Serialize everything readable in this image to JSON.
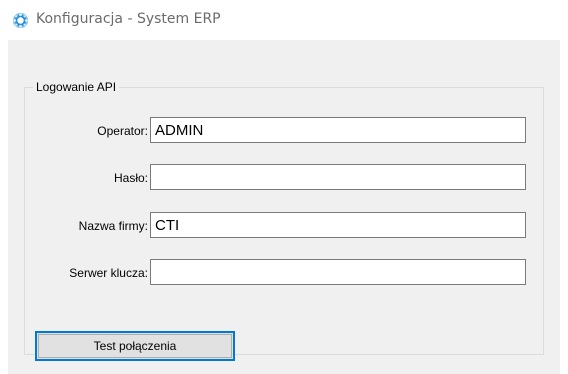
{
  "window": {
    "title": "Konfiguracja - System ERP",
    "icon": "gear-blue-icon"
  },
  "group": {
    "title": "Logowanie API"
  },
  "fields": {
    "operator": {
      "label": "Operator:",
      "value": "ADMIN"
    },
    "password": {
      "label": "Hasło:",
      "value": ""
    },
    "company": {
      "label": "Nazwa firmy:",
      "value": "CTI"
    },
    "key_server": {
      "label": "Serwer klucza:",
      "value": ""
    }
  },
  "buttons": {
    "test_connection": "Test połączenia"
  },
  "colors": {
    "accent": "#0078d7",
    "dialog_background": "#f0f0f0",
    "icon_blue": "#2a8fd8"
  }
}
